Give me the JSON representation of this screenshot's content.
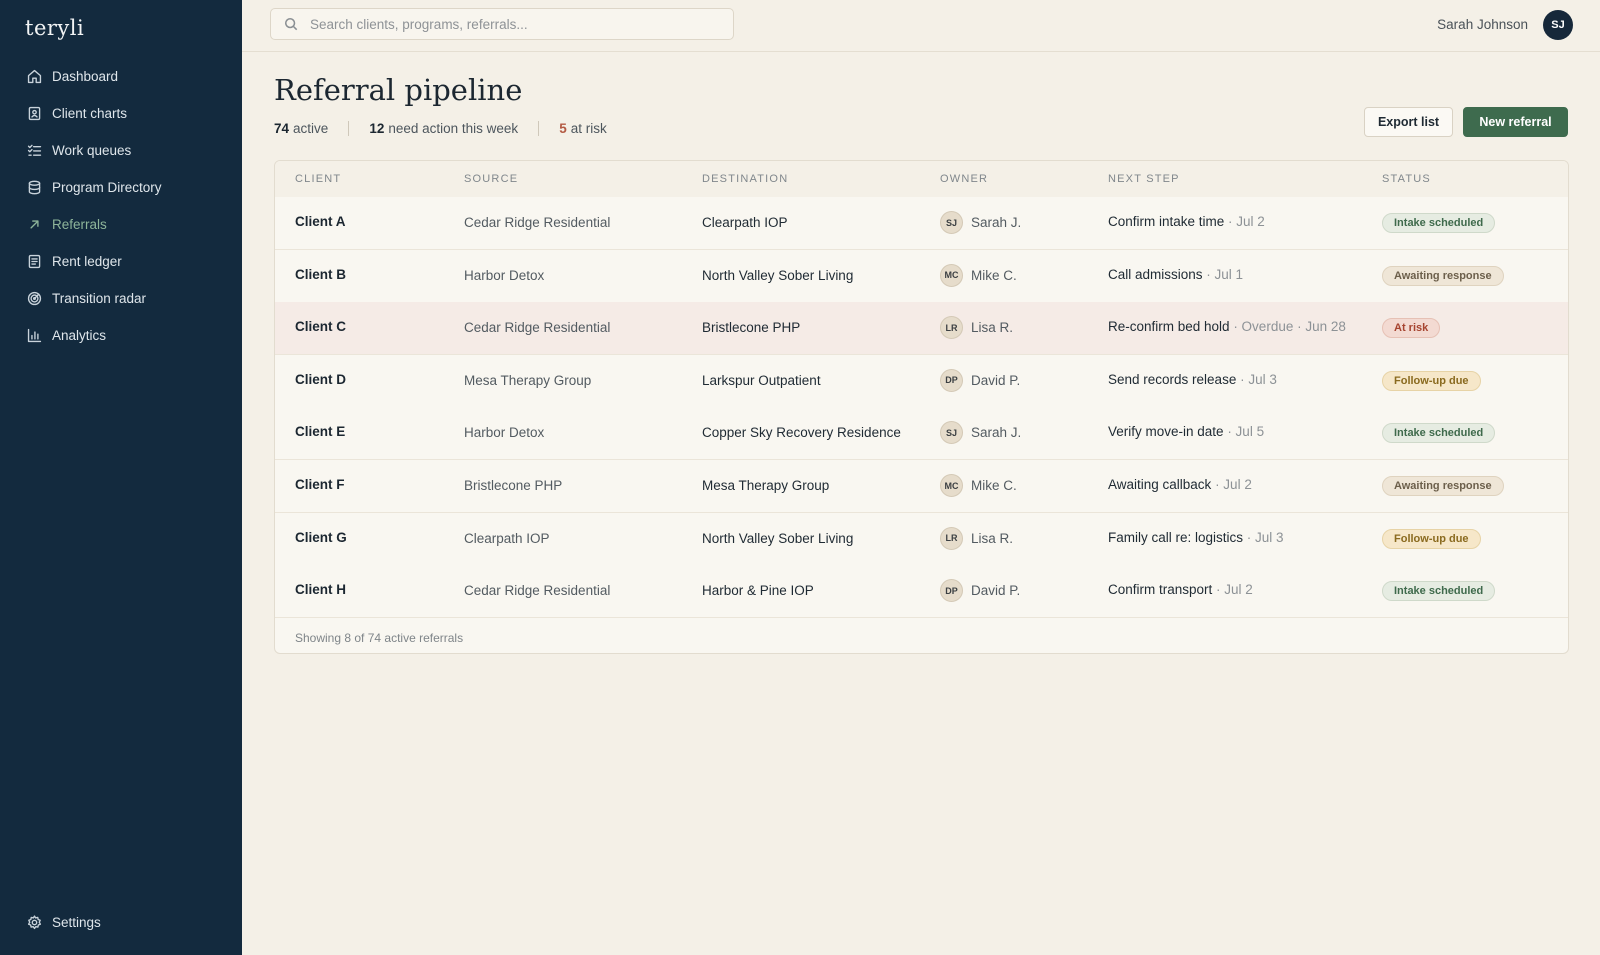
{
  "app": {
    "logo": "teryli"
  },
  "sidebar": {
    "items": [
      {
        "label": "Dashboard",
        "icon": "home-icon"
      },
      {
        "label": "Client charts",
        "icon": "chart-book-icon"
      },
      {
        "label": "Work queues",
        "icon": "list-check-icon"
      },
      {
        "label": "Program Directory",
        "icon": "database-icon"
      },
      {
        "label": "Referrals",
        "icon": "arrow-up-right-icon",
        "active": true
      },
      {
        "label": "Rent ledger",
        "icon": "ledger-icon"
      },
      {
        "label": "Transition radar",
        "icon": "radar-icon"
      },
      {
        "label": "Analytics",
        "icon": "bar-chart-icon"
      }
    ],
    "settings_label": "Settings"
  },
  "topbar": {
    "search_placeholder": "Search clients, programs, referrals...",
    "user_name": "Sarah Johnson",
    "user_initials": "SJ"
  },
  "page": {
    "title": "Referral pipeline",
    "stats": [
      {
        "value": "74",
        "label": "active"
      },
      {
        "value": "12",
        "label": "need action this week"
      },
      {
        "value": "5",
        "label": "at risk"
      }
    ],
    "export_label": "Export list",
    "new_label": "New referral"
  },
  "table": {
    "columns": [
      "CLIENT",
      "SOURCE",
      "DESTINATION",
      "OWNER",
      "NEXT STEP",
      "STATUS"
    ],
    "rows": [
      {
        "client": "Client A",
        "source": "Cedar Ridge Residential",
        "destination": "Clearpath IOP",
        "owner_initials": "SJ",
        "owner": "Sarah J.",
        "step": "Confirm intake time",
        "step_date": " · Jul 2",
        "status": "Intake scheduled",
        "status_kind": "intake"
      },
      {
        "client": "Client B",
        "source": "Harbor Detox",
        "destination": "North Valley Sober Living",
        "owner_initials": "MC",
        "owner": "Mike C.",
        "step": "Call admissions",
        "step_date": " · Jul 1",
        "status": "Awaiting response",
        "status_kind": "awaiting"
      },
      {
        "client": "Client C",
        "source": "Cedar Ridge Residential",
        "destination": "Bristlecone PHP",
        "owner_initials": "LR",
        "owner": "Lisa R.",
        "step": "Re-confirm bed hold",
        "step_date": " · Overdue · Jun 28",
        "status": "At risk",
        "status_kind": "atrisk"
      },
      {
        "client": "Client D",
        "source": "Mesa Therapy Group",
        "destination": "Larkspur Outpatient",
        "owner_initials": "DP",
        "owner": "David P.",
        "step": "Send records release",
        "step_date": " · Jul 3",
        "status": "Follow-up due",
        "status_kind": "followup"
      },
      {
        "client": "Client E",
        "source": "Harbor Detox",
        "destination": "Copper Sky Recovery Residence",
        "owner_initials": "SJ",
        "owner": "Sarah J.",
        "step": "Verify move-in date",
        "step_date": " · Jul 5",
        "status": "Intake scheduled",
        "status_kind": "intake"
      },
      {
        "client": "Client F",
        "source": "Bristlecone PHP",
        "destination": "Mesa Therapy Group",
        "owner_initials": "MC",
        "owner": "Mike C.",
        "step": "Awaiting callback",
        "step_date": " · Jul 2",
        "status": "Awaiting response",
        "status_kind": "awaiting"
      },
      {
        "client": "Client G",
        "source": "Clearpath IOP",
        "destination": "North Valley Sober Living",
        "owner_initials": "LR",
        "owner": "Lisa R.",
        "step": "Family call re: logistics",
        "step_date": " · Jul 3",
        "status": "Follow-up due",
        "status_kind": "followup"
      },
      {
        "client": "Client H",
        "source": "Cedar Ridge Residential",
        "destination": "Harbor & Pine IOP",
        "owner_initials": "DP",
        "owner": "David P.",
        "step": "Confirm transport",
        "step_date": " · Jul 2",
        "status": "Intake scheduled",
        "status_kind": "intake"
      }
    ],
    "footer": "Showing 8 of 74 active referrals"
  },
  "colors": {
    "sidebar_bg": "#132a3e",
    "accent_green": "#3e6b4e",
    "risk_red": "#b35a43",
    "page_bg": "#f4f0e7"
  }
}
